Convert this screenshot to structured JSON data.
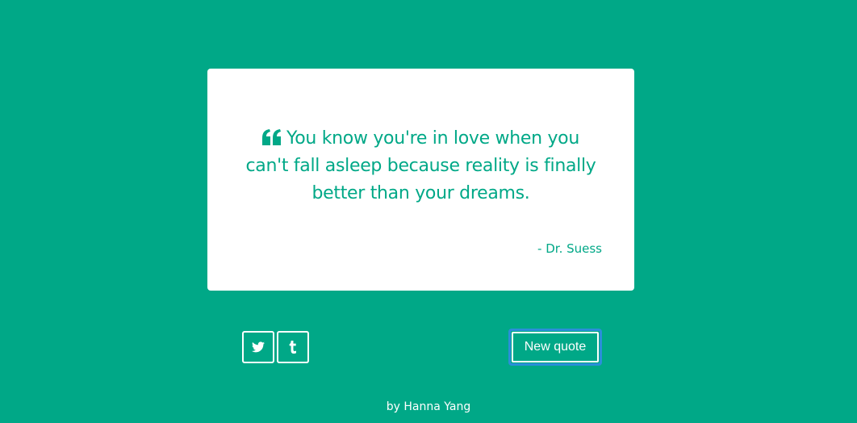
{
  "quote": {
    "text": "You know you're in love when you can't fall asleep because reality is finally better than your dreams.",
    "author": "- Dr. Suess",
    "icon": "quote-left-icon"
  },
  "share": {
    "twitter_icon": "twitter-icon",
    "tumblr_icon": "tumblr-icon"
  },
  "actions": {
    "new_quote_label": "New quote"
  },
  "footer": {
    "credit": "by Hanna Yang"
  },
  "colors": {
    "background": "#00a887",
    "card": "#ffffff",
    "focus_ring": "#2a8fd9"
  }
}
